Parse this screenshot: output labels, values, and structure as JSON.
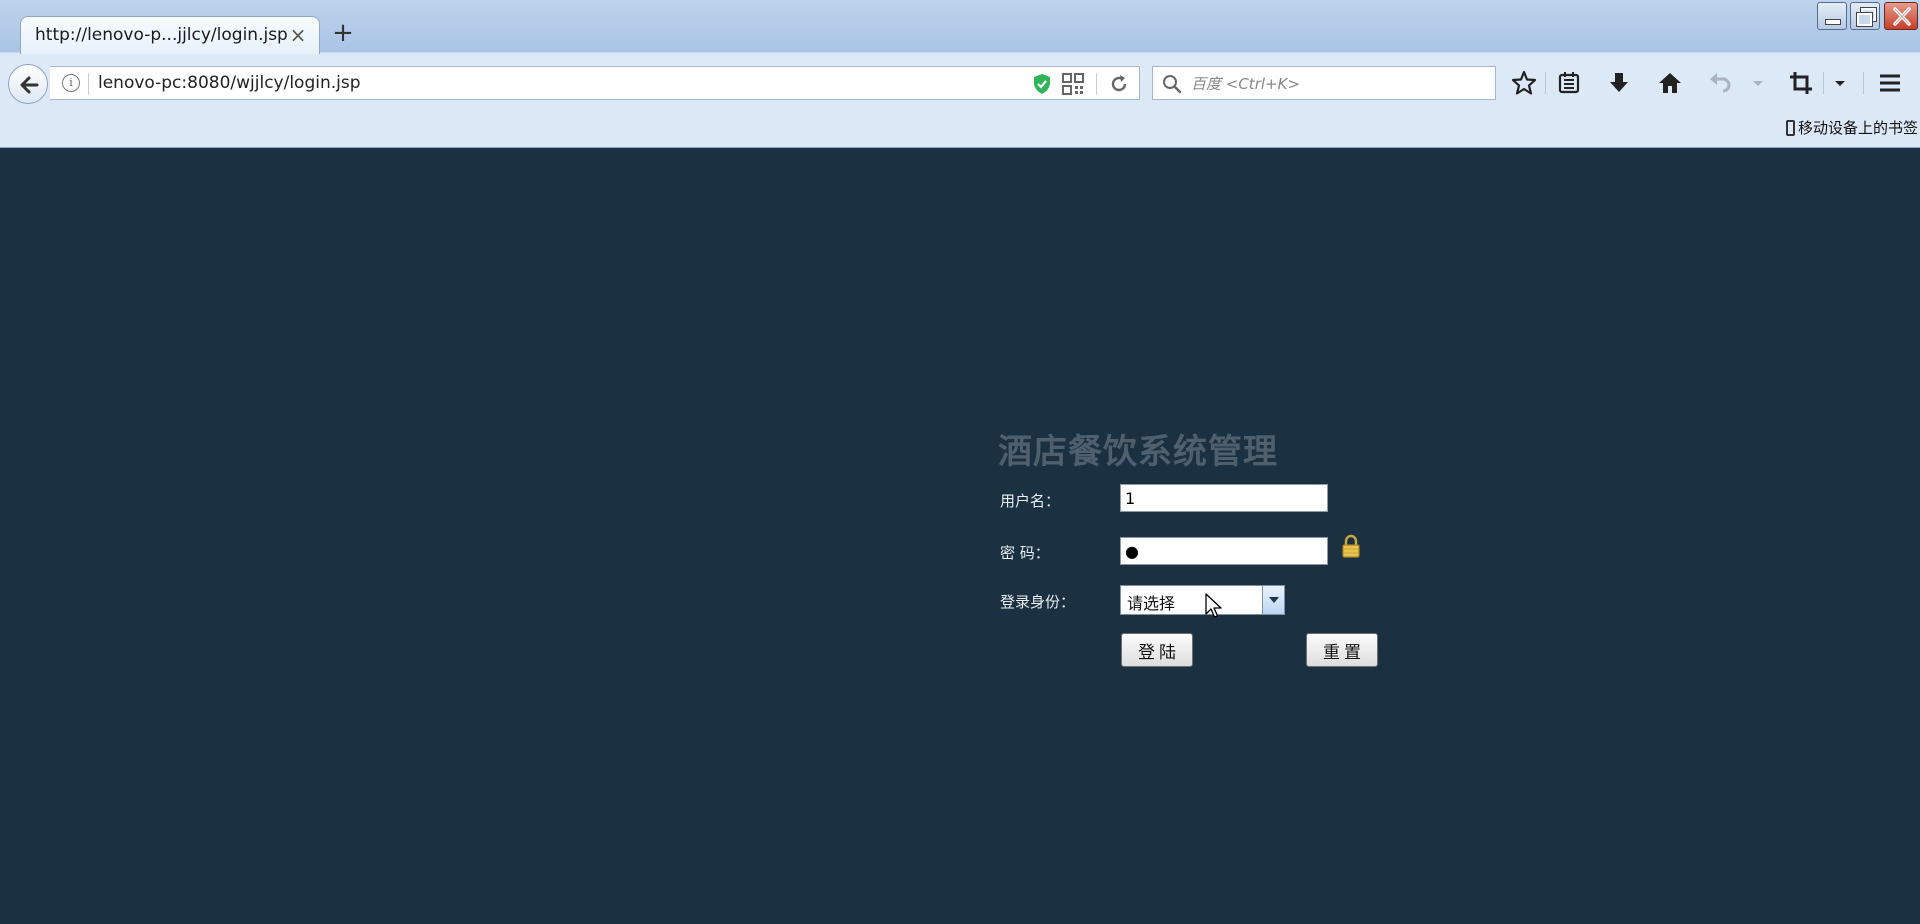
{
  "browser": {
    "tab_title": "http://lenovo-p...jjlcy/login.jsp",
    "tab_close": "×",
    "new_tab": "+",
    "url": "lenovo-pc:8080/wjjlcy/login.jsp",
    "search_placeholder": "百度 <Ctrl+K>",
    "bookmarks_mobile": "移动设备上的书签"
  },
  "login": {
    "title": "酒店餐饮系统管理",
    "username_label": "用户名：",
    "username_value": "1",
    "password_label": "密 码：",
    "password_value": "●",
    "role_label": "登录身份：",
    "role_selected": "请选择",
    "login_button": "登陆",
    "reset_button": "重置"
  },
  "colors": {
    "page_background": "#1b3142",
    "title_color": "#4f5f6c"
  }
}
